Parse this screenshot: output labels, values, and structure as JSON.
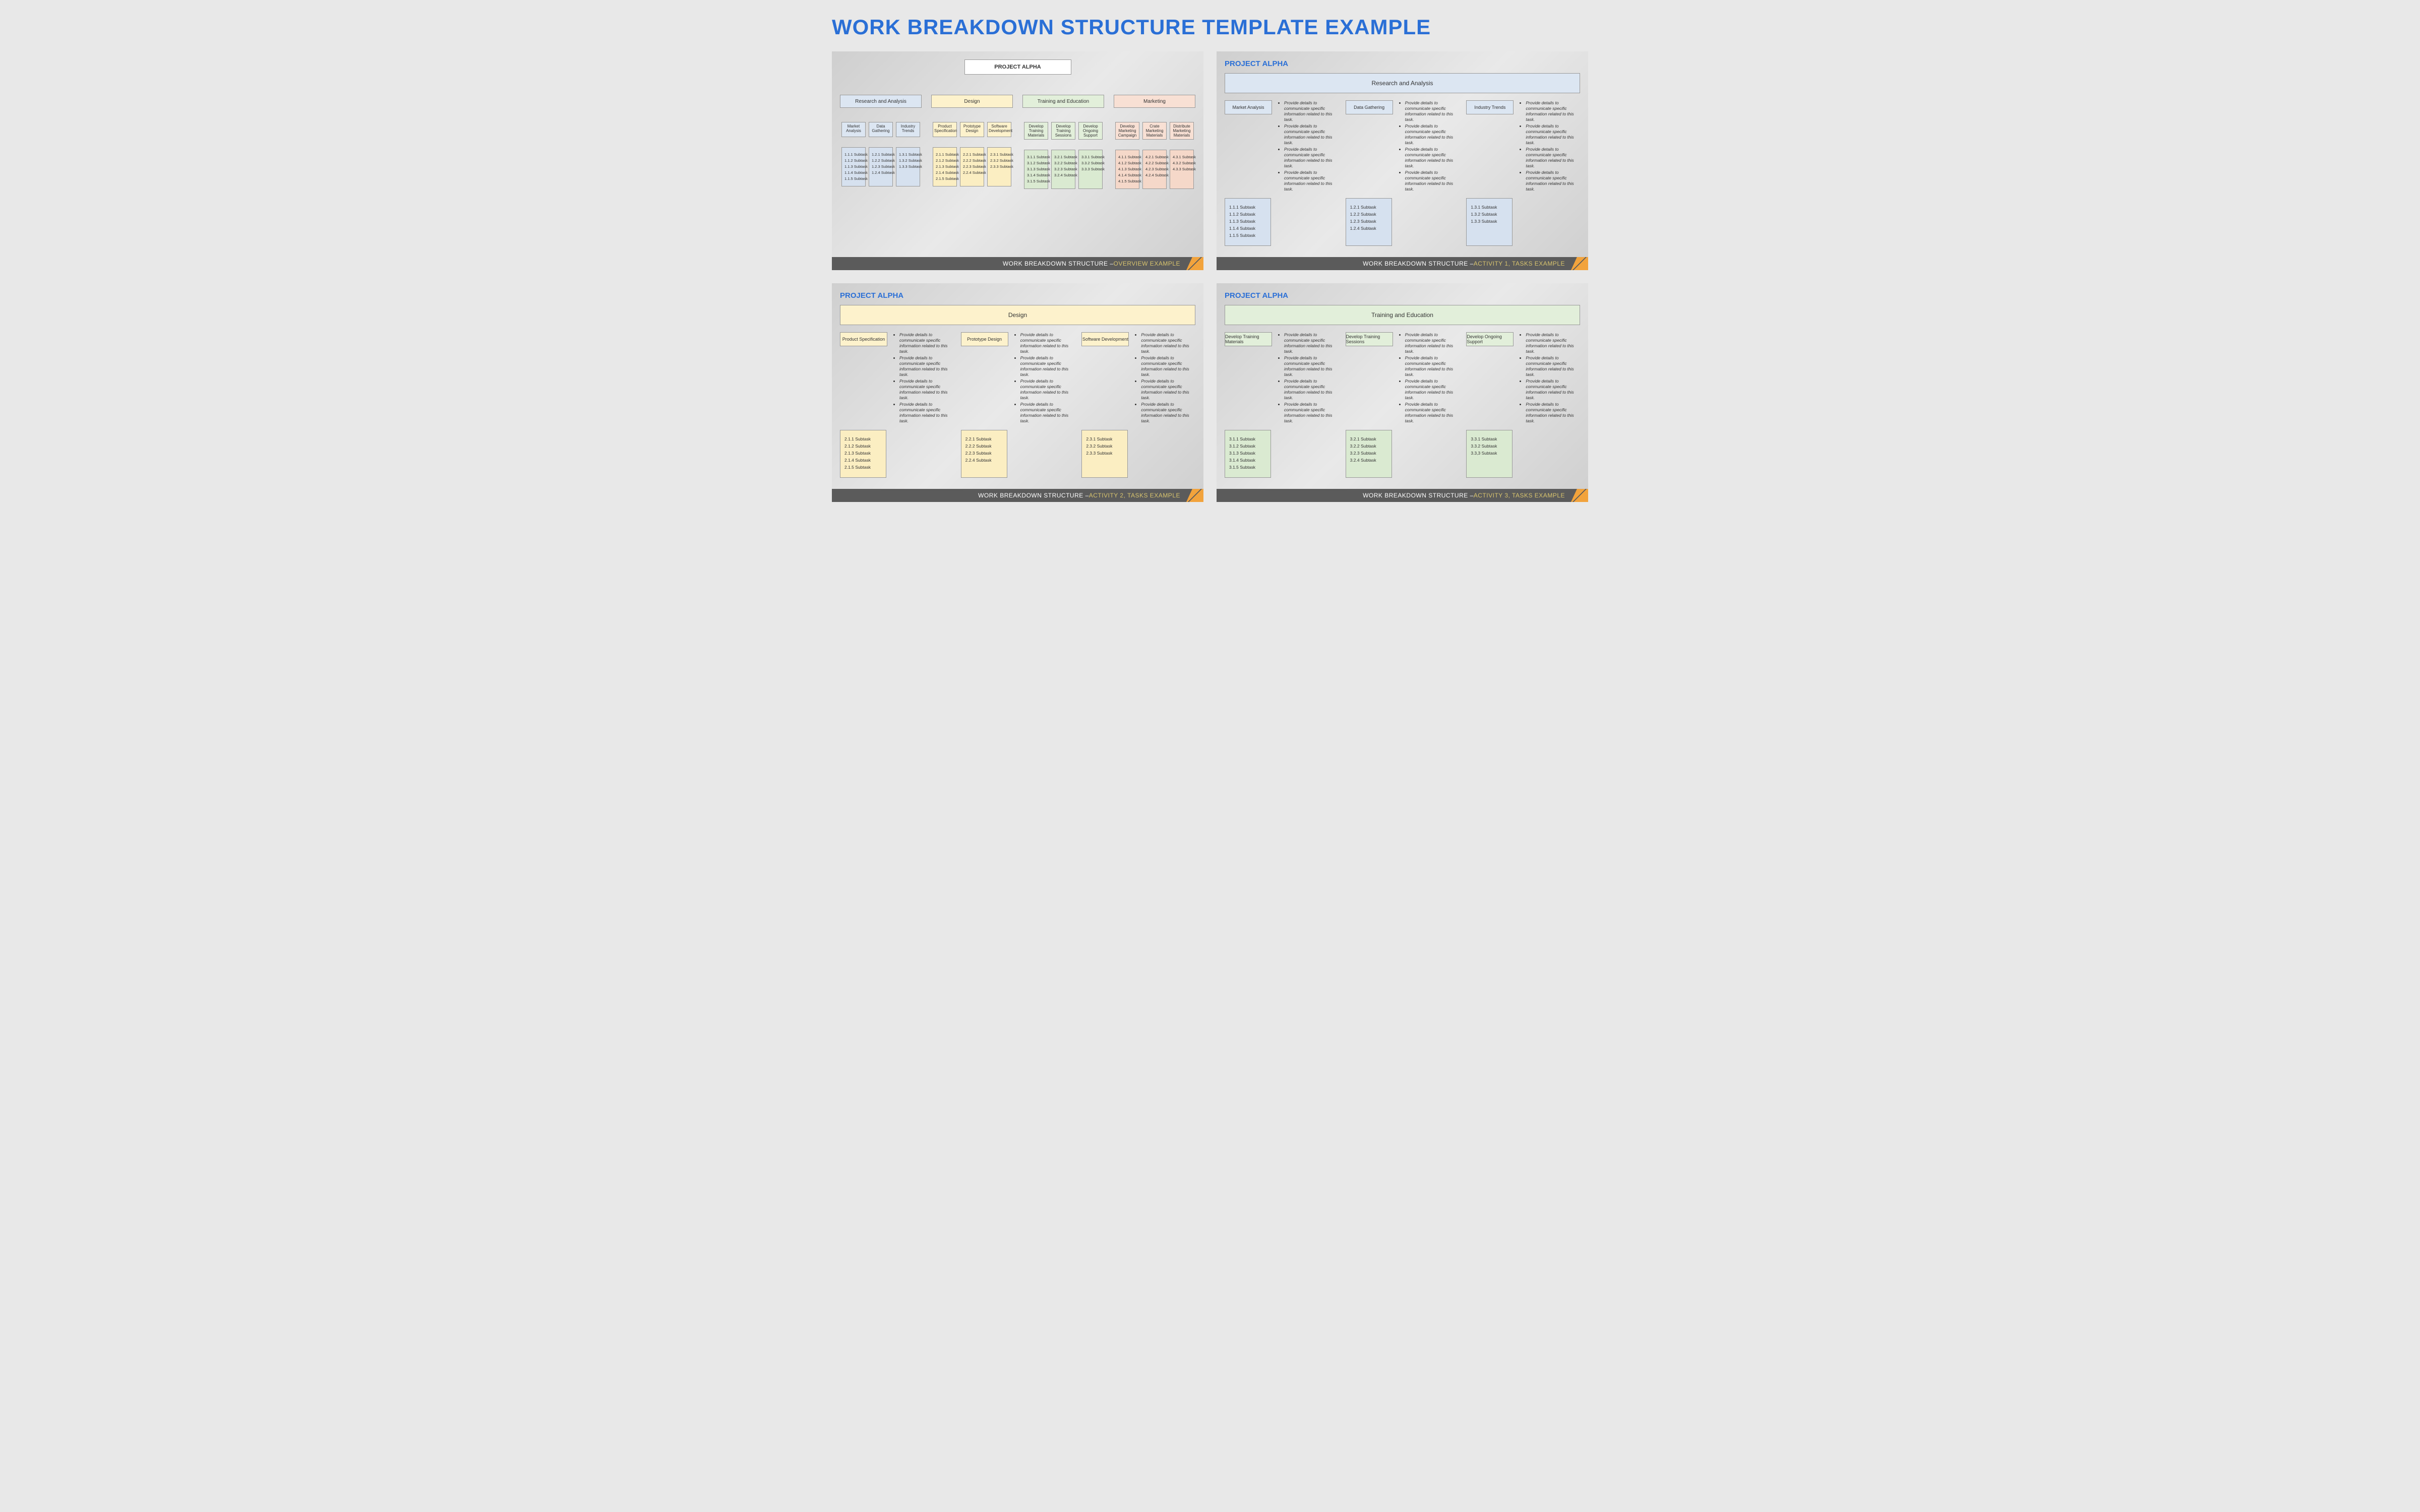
{
  "title": "WORK BREAKDOWN STRUCTURE TEMPLATE EXAMPLE",
  "project": "PROJECT ALPHA",
  "footers": {
    "p1": {
      "a": "WORK BREAKDOWN STRUCTURE – ",
      "b": "OVERVIEW EXAMPLE"
    },
    "p2": {
      "a": "WORK BREAKDOWN STRUCTURE – ",
      "b": "ACTIVITY 1, TASKS EXAMPLE"
    },
    "p3": {
      "a": "WORK BREAKDOWN STRUCTURE – ",
      "b": "ACTIVITY 2, TASKS EXAMPLE"
    },
    "p4": {
      "a": "WORK BREAKDOWN STRUCTURE – ",
      "b": "ACTIVITY 3, TASKS EXAMPLE"
    }
  },
  "overview": {
    "root": "PROJECT ALPHA",
    "cats": [
      {
        "name": "Research and Analysis",
        "color": "blue",
        "acts": [
          {
            "n": "Market Analysis",
            "subs": [
              "1.1.1 Subtask",
              "1.1.2 Subtask",
              "1.1.3 Subtask",
              "1.1.4 Subtask",
              "1.1.5 Subtask"
            ]
          },
          {
            "n": "Data Gathering",
            "subs": [
              "1.2.1 Subtask",
              "1.2.2 Subtask",
              "1.2.3 Subtask",
              "1.2.4 Subtask"
            ]
          },
          {
            "n": "Industry Trends",
            "subs": [
              "1.3.1 Subtask",
              "1.3.2 Subtask",
              "1.3.3 Subtask"
            ]
          }
        ]
      },
      {
        "name": "Design",
        "color": "yellow",
        "acts": [
          {
            "n": "Product Specification",
            "subs": [
              "2.1.1 Subtask",
              "2.1.2 Subtask",
              "2.1.3 Subtask",
              "2.1.4 Subtask",
              "2.1.5 Subtask"
            ]
          },
          {
            "n": "Prototype Design",
            "subs": [
              "2.2.1 Subtask",
              "2.2.2 Subtask",
              "2.2.3 Subtask",
              "2.2.4 Subtask"
            ]
          },
          {
            "n": "Software Development",
            "subs": [
              "2.3.1 Subtask",
              "2.3.2 Subtask",
              "2.3.3 Subtask"
            ]
          }
        ]
      },
      {
        "name": "Training and Education",
        "color": "green",
        "acts": [
          {
            "n": "Develop Training Materials",
            "subs": [
              "3.1.1 Subtask",
              "3.1.2 Subtask",
              "3.1.3 Subtask",
              "3.1.4 Subtask",
              "3.1.5 Subtask"
            ]
          },
          {
            "n": "Develop Training Sessions",
            "subs": [
              "3.2.1 Subtask",
              "3.2.2 Subtask",
              "3.2.3 Subtask",
              "3.2.4 Subtask"
            ]
          },
          {
            "n": "Develop Ongoing Support",
            "subs": [
              "3.3.1 Subtask",
              "3.3.2 Subtask",
              "3.3.3 Subtask"
            ]
          }
        ]
      },
      {
        "name": "Marketing",
        "color": "orange",
        "acts": [
          {
            "n": "Develop Marketing Campaign",
            "subs": [
              "4.1.1 Subtask",
              "4.1.2 Subtask",
              "4.1.3 Subtask",
              "4.1.4 Subtask",
              "4.1.5 Subtask"
            ]
          },
          {
            "n": "Crate Marketing Materials",
            "subs": [
              "4.2.1 Subtask",
              "4.2.2 Subtask",
              "4.2.3 Subtask",
              "4.2.4 Subtask"
            ]
          },
          {
            "n": "Distribute Marketing Materials",
            "subs": [
              "4.3.1 Subtask",
              "4.3.2 Subtask",
              "4.3.3 Subtask"
            ]
          }
        ]
      }
    ]
  },
  "detailBullet": "Provide details to communicate specific information related to this task.",
  "details": [
    {
      "header": "Research and Analysis",
      "color": "blue",
      "cols": [
        {
          "n": "Market Analysis",
          "subs": [
            "1.1.1 Subtask",
            "1.1.2 Subtask",
            "1.1.3 Subtask",
            "1.1.4 Subtask",
            "1.1.5 Subtask"
          ]
        },
        {
          "n": "Data Gathering",
          "subs": [
            "1.2.1 Subtask",
            "1.2.2 Subtask",
            "1.2.3 Subtask",
            "1.2.4 Subtask"
          ]
        },
        {
          "n": "Industry Trends",
          "subs": [
            "1.3.1 Subtask",
            "1.3.2 Subtask",
            "1.3.3 Subtask"
          ]
        }
      ]
    },
    {
      "header": "Design",
      "color": "yellow",
      "cols": [
        {
          "n": "Product Specification",
          "subs": [
            "2.1.1 Subtask",
            "2.1.2 Subtask",
            "2.1.3 Subtask",
            "2.1.4 Subtask",
            "2.1.5 Subtask"
          ]
        },
        {
          "n": "Prototype Design",
          "subs": [
            "2.2.1 Subtask",
            "2.2.2 Subtask",
            "2.2.3 Subtask",
            "2.2.4 Subtask"
          ]
        },
        {
          "n": "Software Development",
          "subs": [
            "2.3.1 Subtask",
            "2.3.2 Subtask",
            "2.3.3 Subtask"
          ]
        }
      ]
    },
    {
      "header": "Training and Education",
      "color": "green",
      "cols": [
        {
          "n": "Develop Training Materials",
          "subs": [
            "3.1.1 Subtask",
            "3.1.2 Subtask",
            "3.1.3 Subtask",
            "3.1.4 Subtask",
            "3.1.5 Subtask"
          ]
        },
        {
          "n": "Develop Training Sessions",
          "subs": [
            "3.2.1 Subtask",
            "3.2.2 Subtask",
            "3.2.3 Subtask",
            "3.2.4 Subtask"
          ]
        },
        {
          "n": "Develop Ongoing Support",
          "subs": [
            "3.3.1 Subtask",
            "3.3.2 Subtask",
            "3.3,3 Subtask"
          ]
        }
      ]
    }
  ]
}
